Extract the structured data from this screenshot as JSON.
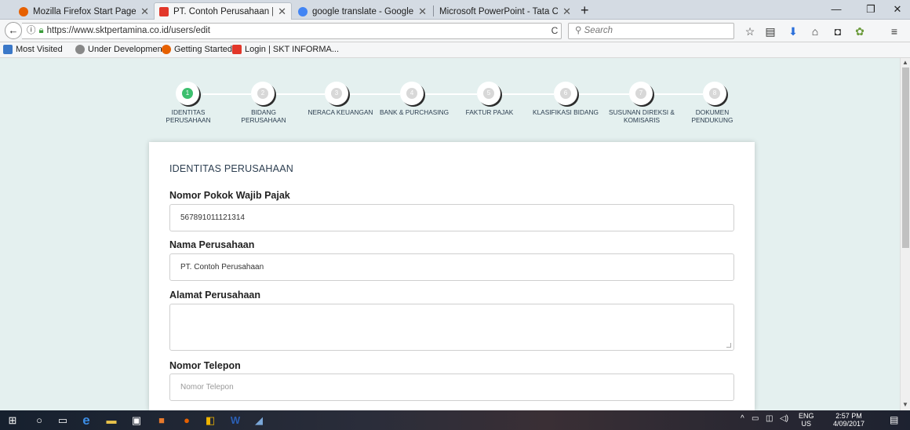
{
  "tabs": [
    {
      "title": "Mozilla Firefox Start Page",
      "fav": "#e66000"
    },
    {
      "title": "PT. Contoh Perusahaan | SKT",
      "fav": "#e2372a"
    },
    {
      "title": "google translate - Google Se",
      "fav": "#4285f4"
    },
    {
      "title": "Microsoft PowerPoint - Tata Car",
      "fav": ""
    }
  ],
  "nav": {
    "url": "https://www.sktpertamina.co.id/users/edit",
    "search_placeholder": "Search"
  },
  "bookmarks": [
    {
      "label": "Most Visited"
    },
    {
      "label": "Under Development"
    },
    {
      "label": "Getting Started"
    },
    {
      "label": "Login | SKT INFORMA..."
    }
  ],
  "steps": [
    {
      "num": "1",
      "label": "IDENTITAS PERUSAHAAN"
    },
    {
      "num": "2",
      "label": "BIDANG PERUSAHAAN"
    },
    {
      "num": "3",
      "label": "NERACA KEUANGAN"
    },
    {
      "num": "4",
      "label": "BANK & PURCHASING"
    },
    {
      "num": "5",
      "label": "FAKTUR PAJAK"
    },
    {
      "num": "6",
      "label": "KLASIFIKASI BIDANG"
    },
    {
      "num": "7",
      "label": "SUSUNAN DIREKSI & KOMISARIS"
    },
    {
      "num": "8",
      "label": "DOKUMEN PENDUKUNG"
    }
  ],
  "form": {
    "section_title": "IDENTITAS PERUSAHAAN",
    "npwp_label": "Nomor Pokok Wajib Pajak",
    "npwp_value": "567891011121314",
    "nama_label": "Nama Perusahaan",
    "nama_value": "PT. Contoh Perusahaan",
    "alamat_label": "Alamat Perusahaan",
    "alamat_value": "",
    "telepon_label": "Nomor Telepon",
    "telepon_placeholder": "Nomor Telepon"
  },
  "tray": {
    "lang": "ENG",
    "region": "US",
    "time": "2:57 PM",
    "date": "4/09/2017"
  }
}
